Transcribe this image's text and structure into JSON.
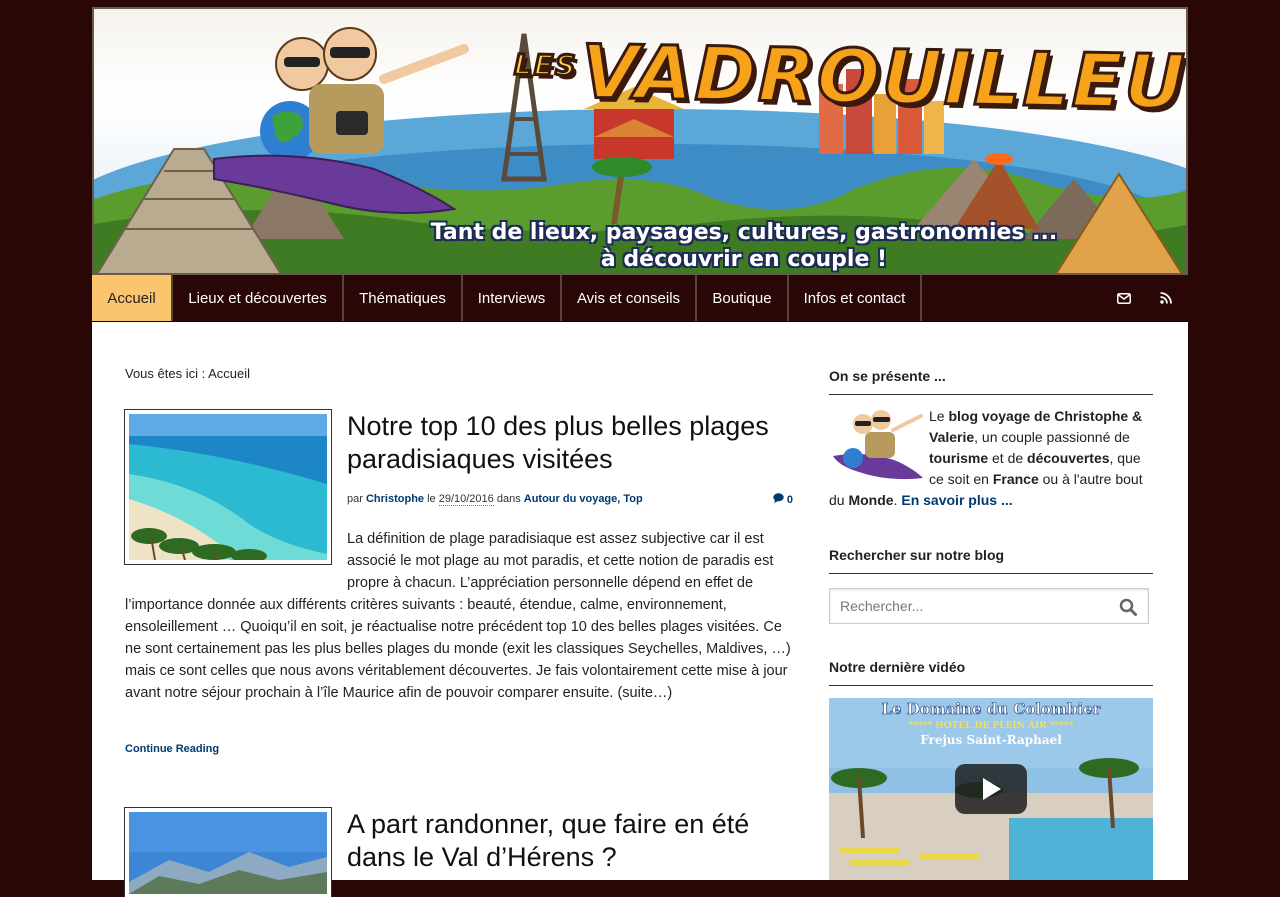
{
  "header": {
    "title_small": "LES",
    "title_main": "VADROUILLEURS",
    "tagline_line1": "Tant de lieux, paysages, cultures, gastronomies ...",
    "tagline_line2": "à découvrir en couple !"
  },
  "nav": {
    "items": [
      {
        "label": "Accueil",
        "active": true
      },
      {
        "label": "Lieux et découvertes"
      },
      {
        "label": "Thématiques"
      },
      {
        "label": "Interviews"
      },
      {
        "label": "Avis et conseils"
      },
      {
        "label": "Boutique"
      },
      {
        "label": "Infos et contact"
      }
    ],
    "icons": [
      "envelope-icon",
      "rss-icon"
    ]
  },
  "breadcrumb": "Vous êtes ici : Accueil",
  "posts": [
    {
      "title": "Notre top 10 des plus belles plages paradisiaques visitées",
      "meta_by": "par",
      "author": "Christophe",
      "meta_on": "le",
      "date": "29/10/2016",
      "meta_in": "dans",
      "categories": [
        "Autour du voyage",
        "Top"
      ],
      "comments": "0",
      "excerpt": "La définition de plage paradisiaque est assez subjective car il est associé le mot plage au mot paradis, et cette notion de paradis est propre à chacun. L’appréciation personnelle dépend en effet de l’importance donnée aux différents critères suivants : beauté, étendue, calme, environnement, ensoleillement … Quoiqu’il en soit, je réactualise notre précédent top 10 des belles plages visitées. Ce ne sont certainement pas les plus belles plages du monde (exit les classiques Seychelles, Maldives, …) mais ce sont celles que nous avons véritablement découvertes. Je fais volontairement cette mise à jour avant notre séjour prochain à l’île Maurice afin de pouvoir comparer ensuite. (suite…)",
      "continue_label": "Continue Reading"
    },
    {
      "title": "A part randonner, que faire en été dans le Val d’Hérens ?"
    }
  ],
  "sidebar": {
    "about_title": "On se présente ...",
    "about": {
      "p1": "Le ",
      "b1": "blog voyage de Christophe & Valerie",
      "p2": ", un couple passionné de ",
      "b2": "tourisme",
      "p3": " et de ",
      "b3": "découvertes",
      "p4": ", que ce soit en ",
      "b4": "France",
      "p5": " ou à l'autre bout du ",
      "b5": "Monde",
      "p6": ". ",
      "link": "En savoir plus ..."
    },
    "search_title": "Rechercher sur notre blog",
    "search_placeholder": "Rechercher...",
    "video_title": "Notre dernière vidéo",
    "video": {
      "heading": "Le Domaine du Colombier",
      "stars_line": "***** HOTEL DE PLEIN AIR *****",
      "location": "Frejus Saint-Raphael"
    }
  },
  "colors": {
    "page_bg": "#2a0707",
    "nav_active": "#fbc56e",
    "link": "#003a6f"
  }
}
